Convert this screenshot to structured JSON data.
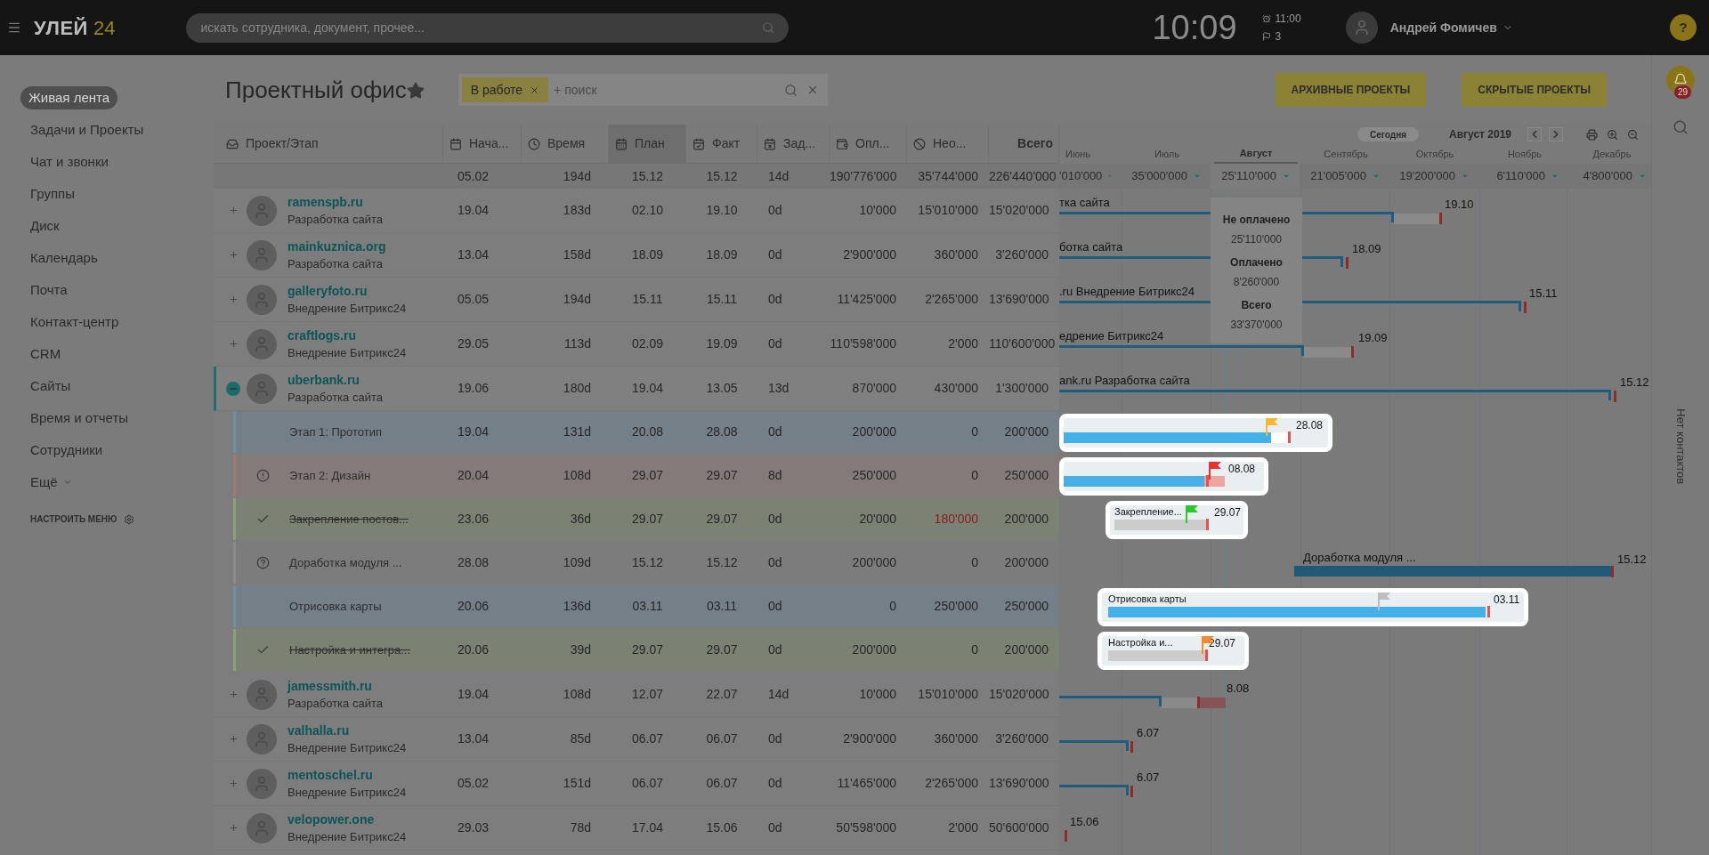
{
  "topbar": {
    "logo_text": "УЛЕЙ",
    "logo_number": "24",
    "search_placeholder": "искать сотрудника, документ, прочее...",
    "clock": "10:09",
    "alarm": "11:00",
    "flags": "3",
    "user": "Андрей Фомичев",
    "help": "?"
  },
  "sidebar": {
    "items": [
      {
        "label": "Живая лента",
        "selected": true,
        "dropdown": false
      },
      {
        "label": "Задачи и Проекты",
        "selected": false,
        "dropdown": false
      },
      {
        "label": "Чат и звонки",
        "selected": false,
        "dropdown": false
      },
      {
        "label": "Группы",
        "selected": false,
        "dropdown": false
      },
      {
        "label": "Диск",
        "selected": false,
        "dropdown": false
      },
      {
        "label": "Календарь",
        "selected": false,
        "dropdown": false
      },
      {
        "label": "Почта",
        "selected": false,
        "dropdown": false
      },
      {
        "label": "Контакт-центр",
        "selected": false,
        "dropdown": false
      },
      {
        "label": "CRM",
        "selected": false,
        "dropdown": false
      },
      {
        "label": "Сайты",
        "selected": false,
        "dropdown": false
      },
      {
        "label": "Время и отчеты",
        "selected": false,
        "dropdown": false
      },
      {
        "label": "Сотрудники",
        "selected": false,
        "dropdown": false
      },
      {
        "label": "Ещё",
        "selected": false,
        "dropdown": true
      }
    ],
    "settings": "НАСТРОИТЬ МЕНЮ"
  },
  "page": {
    "title": "Проектный офис",
    "filter": {
      "tag": "В работе",
      "placeholder": "+ поиск"
    },
    "buttons": [
      "АРХИВНЫЕ ПРОЕКТЫ",
      "СКРЫТЫЕ ПРОЕКТЫ"
    ]
  },
  "right_panel": {
    "badge": "29",
    "empty_text": "Нет контактов"
  },
  "table": {
    "columns": [
      {
        "label": "Проект/Этап",
        "selected": false
      },
      {
        "label": "Нача...",
        "selected": false
      },
      {
        "label": "Время",
        "selected": false
      },
      {
        "label": "План",
        "selected": true
      },
      {
        "label": "Факт",
        "selected": false
      },
      {
        "label": "Зад...",
        "selected": false
      },
      {
        "label": "Опл...",
        "selected": false
      },
      {
        "label": "Нео...",
        "selected": false
      },
      {
        "label": "Всего",
        "selected": false
      }
    ],
    "totals": [
      "05.02",
      "194d",
      "15.12",
      "15.12",
      "14d",
      "190'776'000",
      "35'744'000",
      "226'440'000"
    ],
    "rows": [
      {
        "kind": "project",
        "name": "ramenspb.ru",
        "subtitle": "Разработка сайта",
        "expanded": false,
        "values": [
          "19.04",
          "183d",
          "02.10",
          "19.10",
          "0d",
          "10'000",
          "15'010'000",
          "15'020'000"
        ]
      },
      {
        "kind": "project",
        "name": "mainkuznica.org",
        "subtitle": "Разработка сайта",
        "expanded": false,
        "values": [
          "13.04",
          "158d",
          "18.09",
          "18.09",
          "0d",
          "2'900'000",
          "360'000",
          "3'260'000"
        ]
      },
      {
        "kind": "project",
        "name": "galleryfoto.ru",
        "subtitle": "Внедрение Битрикс24",
        "expanded": false,
        "values": [
          "05.05",
          "194d",
          "15.11",
          "15.11",
          "0d",
          "11'425'000",
          "2'265'000",
          "13'690'000"
        ]
      },
      {
        "kind": "project",
        "name": "craftlogs.ru",
        "subtitle": "Внедрение Битрикс24",
        "expanded": false,
        "values": [
          "29.05",
          "113d",
          "02.09",
          "19.09",
          "0d",
          "110'598'000",
          "2'000",
          "110'600'000"
        ]
      },
      {
        "kind": "project",
        "name": "uberbank.ru",
        "subtitle": "Разработка сайта",
        "expanded": true,
        "values": [
          "19.06",
          "180d",
          "19.04",
          "13.05",
          "13d",
          "870'000",
          "430'000",
          "1'300'000"
        ]
      },
      {
        "kind": "stage_plain",
        "name": "Этап 1: Прототип",
        "done": false,
        "unpaid_alert": false,
        "values": [
          "19.04",
          "131d",
          "20.08",
          "28.08",
          "0d",
          "200'000",
          "0",
          "200'000"
        ]
      },
      {
        "kind": "stage_warning",
        "name": "Этап 2: Дизайн",
        "done": false,
        "unpaid_alert": false,
        "values": [
          "20.04",
          "108d",
          "29.07",
          "29.07",
          "8d",
          "250'000",
          "0",
          "250'000"
        ]
      },
      {
        "kind": "stage_done",
        "name": "Закрепление постов...",
        "done": true,
        "unpaid_alert": true,
        "values": [
          "23.06",
          "36d",
          "29.07",
          "29.07",
          "0d",
          "20'000",
          "180'000",
          "200'000"
        ]
      },
      {
        "kind": "stage_question",
        "name": "Доработка модуля ...",
        "done": false,
        "unpaid_alert": false,
        "values": [
          "28.08",
          "109d",
          "15.12",
          "15.12",
          "0d",
          "200'000",
          "0",
          "200'000"
        ]
      },
      {
        "kind": "stage_plain",
        "name": "Отрисовка карты",
        "done": false,
        "unpaid_alert": false,
        "values": [
          "20.06",
          "136d",
          "03.11",
          "03.11",
          "0d",
          "0",
          "250'000",
          "250'000"
        ]
      },
      {
        "kind": "stage_done",
        "name": "Настройка и интегра...",
        "done": true,
        "unpaid_alert": false,
        "values": [
          "20.06",
          "39d",
          "29.07",
          "29.07",
          "0d",
          "200'000",
          "0",
          "200'000"
        ]
      },
      {
        "kind": "project",
        "name": "jamessmith.ru",
        "subtitle": "Разработка сайта",
        "expanded": false,
        "values": [
          "19.04",
          "108d",
          "12.07",
          "22.07",
          "14d",
          "10'000",
          "15'010'000",
          "15'020'000"
        ]
      },
      {
        "kind": "project",
        "name": "valhalla.ru",
        "subtitle": "Внедрение Битрикс24",
        "expanded": false,
        "values": [
          "13.04",
          "85d",
          "06.07",
          "06.07",
          "0d",
          "2'900'000",
          "360'000",
          "3'260'000"
        ]
      },
      {
        "kind": "project",
        "name": "mentoschel.ru",
        "subtitle": "Внедрение Битрикс24",
        "expanded": false,
        "values": [
          "05.02",
          "151d",
          "06.07",
          "06.07",
          "0d",
          "11'465'000",
          "2'265'000",
          "13'690'000"
        ]
      },
      {
        "kind": "project",
        "name": "velopower.one",
        "subtitle": "Внедрение Битрикс24",
        "expanded": false,
        "values": [
          "29.03",
          "78d",
          "17.04",
          "15.06",
          "0d",
          "50'598'000",
          "2'000",
          "50'600'000"
        ]
      }
    ]
  },
  "gantt": {
    "today": "Сегодня",
    "period": "Август 2019",
    "months": [
      {
        "label": "Июнь",
        "amount": "'010'000",
        "selected": false
      },
      {
        "label": "Июль",
        "amount": "35'000'000",
        "selected": false
      },
      {
        "label": "Август",
        "amount": "25'110'000",
        "selected": true
      },
      {
        "label": "Сентябрь",
        "amount": "21'005'000",
        "selected": false
      },
      {
        "label": "Октябрь",
        "amount": "19'200'000",
        "selected": false
      },
      {
        "label": "Ноябрь",
        "amount": "6'110'000",
        "selected": false
      },
      {
        "label": "Декабрь",
        "amount": "4'800'000",
        "selected": false
      }
    ],
    "tooltip": [
      {
        "label": "Не оплачено",
        "value": "25'110'000"
      },
      {
        "label": "Оплачено",
        "value": "8'260'000"
      },
      {
        "label": "Всего",
        "value": "33'370'000"
      }
    ],
    "rows": [
      {
        "kind": "summary",
        "label": "тка сайта",
        "date": "19.10"
      },
      {
        "kind": "summary",
        "label": "ботка сайта",
        "date": "18.09"
      },
      {
        "kind": "summary",
        "label": ".ru Внедрение Битрикс24",
        "date": "15.11"
      },
      {
        "kind": "summary",
        "label": "едрение Битрикс24",
        "date": "19.09"
      },
      {
        "kind": "summary",
        "label": "ank.ru Разработка сайта",
        "date": "15.12"
      },
      {
        "kind": "card_active",
        "date": "28.08",
        "color": "#f5b82e"
      },
      {
        "kind": "card_active",
        "date": "08.08",
        "color": "#e8302e"
      },
      {
        "kind": "card_idle",
        "label": "Закрепление...",
        "date": "29.07",
        "color": "#2ec52e"
      },
      {
        "kind": "plain",
        "label": "Доработка модуля ...",
        "date": "15.12"
      },
      {
        "kind": "card_active",
        "label": "Отрисовка карты",
        "date": "03.11",
        "color": "#bdbdbd"
      },
      {
        "kind": "card_idle",
        "label": "Настройка и...",
        "date": "29.07",
        "color": "#f58a2e"
      },
      {
        "kind": "summary",
        "date": "8.08"
      },
      {
        "kind": "summary",
        "date": "6.07"
      },
      {
        "kind": "summary",
        "date": "6.07"
      },
      {
        "kind": "summary",
        "date": "15.06"
      }
    ]
  }
}
